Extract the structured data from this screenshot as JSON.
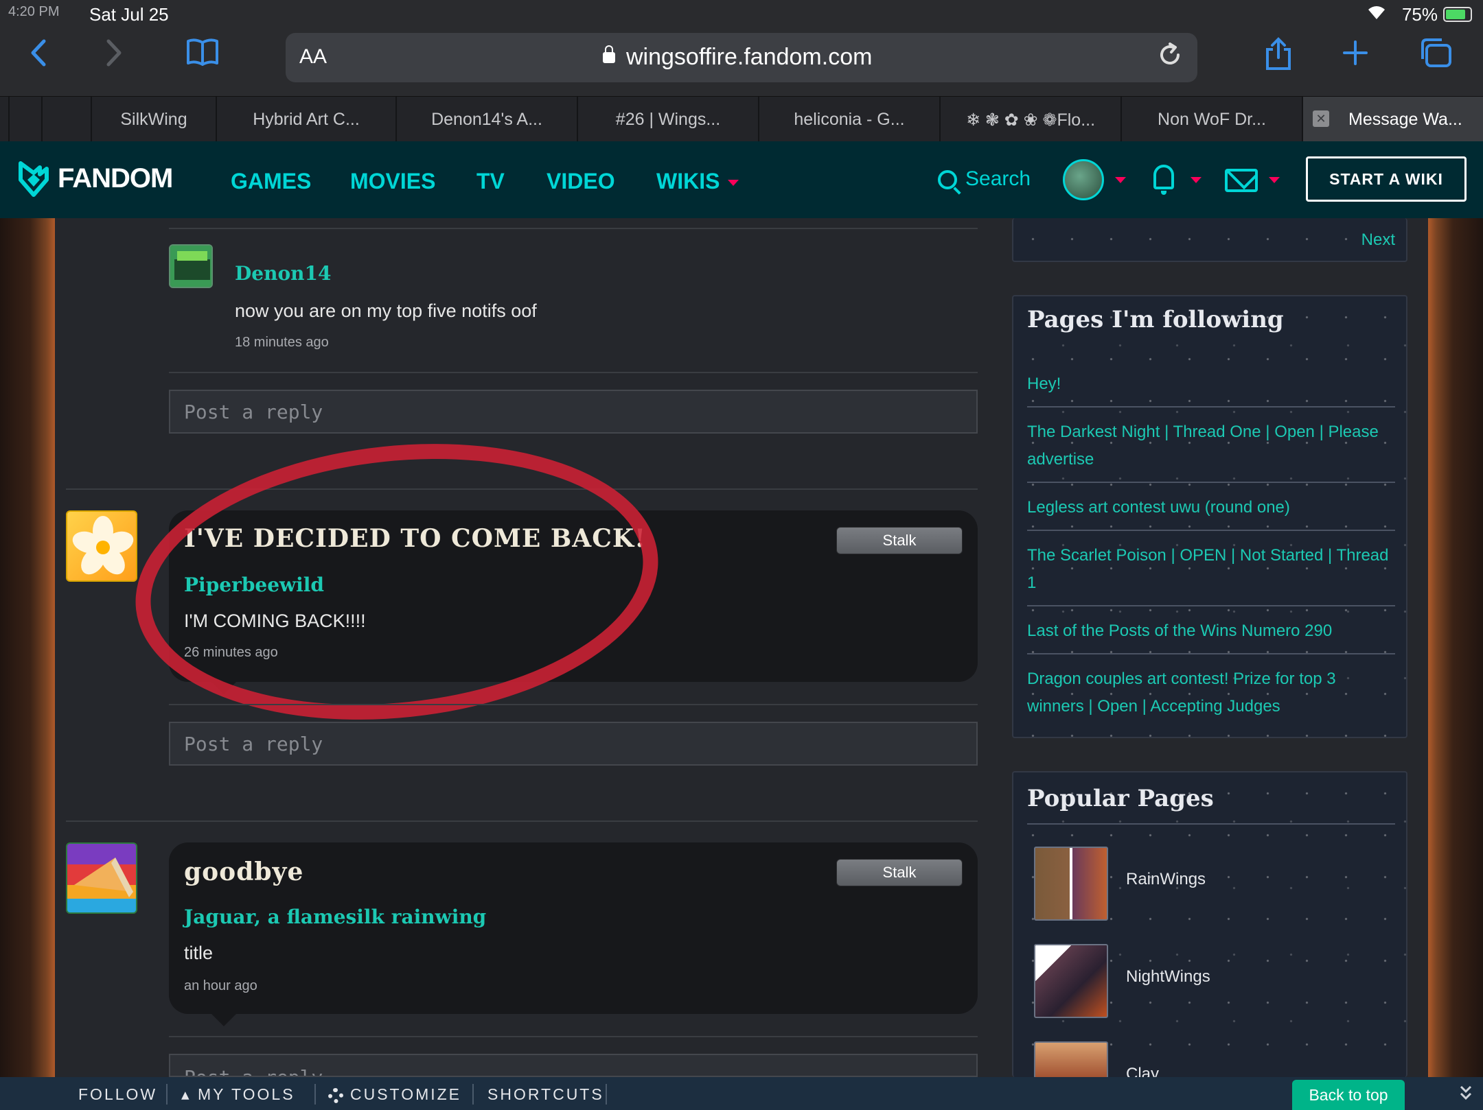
{
  "status_bar": {
    "time": "4:20 PM",
    "date": "Sat Jul 25",
    "battery": "75%"
  },
  "safari": {
    "text_size_label": "AA",
    "url": "wingsoffire.fandom.com",
    "tabs": [
      {
        "label": "SilkWing"
      },
      {
        "label": "Hybrid Art C..."
      },
      {
        "label": "Denon14's A..."
      },
      {
        "label": "#26 | Wings..."
      },
      {
        "label": "heliconia - G..."
      },
      {
        "label": "❄ ❃ ✿ ❀ ❁Flo..."
      },
      {
        "label": "Non WoF Dr..."
      },
      {
        "label": "Message Wa..."
      }
    ],
    "close_glyph": "✕"
  },
  "fandom_nav": {
    "logo": "FANDOM",
    "menu": [
      "GAMES",
      "MOVIES",
      "TV",
      "VIDEO",
      "WIKIS"
    ],
    "search_label": "Search",
    "start_wiki": "START A WIKI"
  },
  "wall": {
    "reply_1": {
      "user": "Denon14",
      "text": "now you are on my top five notifs oof",
      "time": "18 minutes ago"
    },
    "reply_placeholder": "Post a reply",
    "threads": [
      {
        "title": "I'VE DECIDED TO COME BACK!",
        "stalk": "Stalk",
        "user": "Piperbeewild",
        "text": "I'M COMING BACK!!!!",
        "time": "26 minutes ago"
      },
      {
        "title": "goodbye",
        "stalk": "Stalk",
        "user": "Jaguar, a flamesilk rainwing",
        "text": "title",
        "time": "an hour ago"
      }
    ]
  },
  "rail": {
    "next": "Next",
    "following_title": "Pages I'm following",
    "following": [
      "Hey!",
      "The Darkest Night | Thread One | Open | Please advertise",
      "Legless art contest uwu (round one)",
      "The Scarlet Poison | OPEN | Not Started | Thread 1",
      "Last of the Posts of the Wins Numero 290",
      "Dragon couples art contest! Prize for top 3 winners | Open | Accepting Judges"
    ],
    "popular_title": "Popular Pages",
    "popular": [
      "RainWings",
      "NightWings",
      "Clay"
    ]
  },
  "bottom_bar": {
    "follow": "FOLLOW",
    "my_tools": "MY TOOLS",
    "customize": "CUSTOMIZE",
    "shortcuts": "SHORTCUTS",
    "back_to_top": "Back to top"
  },
  "colors": {
    "fandom_nav_bg": "#002a32",
    "accent_teal": "#00d6d6",
    "link_green": "#1cc9b3",
    "fandom_pink": "#fa005a",
    "annotation_red": "#ce2134",
    "back_to_top": "#00b489"
  }
}
